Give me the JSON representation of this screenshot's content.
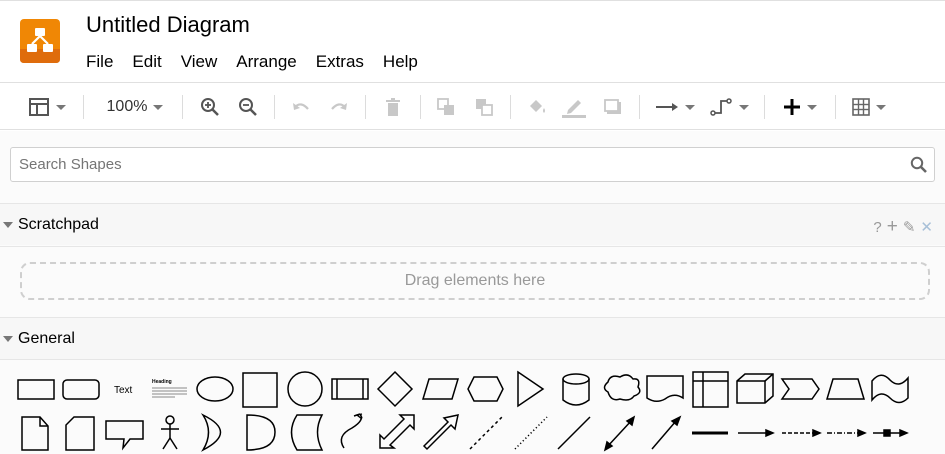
{
  "app": {
    "title": "Untitled Diagram",
    "logo_icon": "drawio-logo-icon",
    "accent_color": "#f08705"
  },
  "menu": [
    "File",
    "Edit",
    "View",
    "Arrange",
    "Extras",
    "Help"
  ],
  "toolbar": {
    "zoom_value": "100%",
    "buttons": [
      "format-panel-icon",
      "zoom-in-icon",
      "zoom-out-icon",
      "undo-icon",
      "redo-icon",
      "delete-icon",
      "to-front-icon",
      "to-back-icon",
      "fill-color-icon",
      "line-color-icon",
      "shadow-icon",
      "connection-icon",
      "waypoints-icon",
      "insert-icon",
      "table-icon"
    ]
  },
  "search": {
    "placeholder": "Search Shapes",
    "value": ""
  },
  "scratchpad": {
    "title": "Scratchpad",
    "help": "?",
    "add": "+",
    "edit": "✎",
    "close": "✕",
    "drop_text": "Drag elements here"
  },
  "general": {
    "title": "General",
    "text_shape_label": "Text",
    "heading_shape_label": "Heading",
    "shapes": [
      "rectangle",
      "rounded-rectangle",
      "text",
      "textbox",
      "ellipse",
      "square",
      "circle",
      "process",
      "diamond",
      "parallelogram",
      "hexagon",
      "triangle",
      "cylinder",
      "cloud",
      "document",
      "internal-storage",
      "cube",
      "step",
      "trapezoid",
      "tape",
      "note",
      "card",
      "callout",
      "actor",
      "or",
      "and",
      "data-storage",
      "curve",
      "bidirectional-arrow",
      "arrow",
      "dashed-line",
      "dotted-line",
      "line",
      "bidirectional-connector",
      "directional-connector",
      "link",
      "edge",
      "edge-dashed",
      "edge-dotted",
      "edge-labeled"
    ]
  }
}
